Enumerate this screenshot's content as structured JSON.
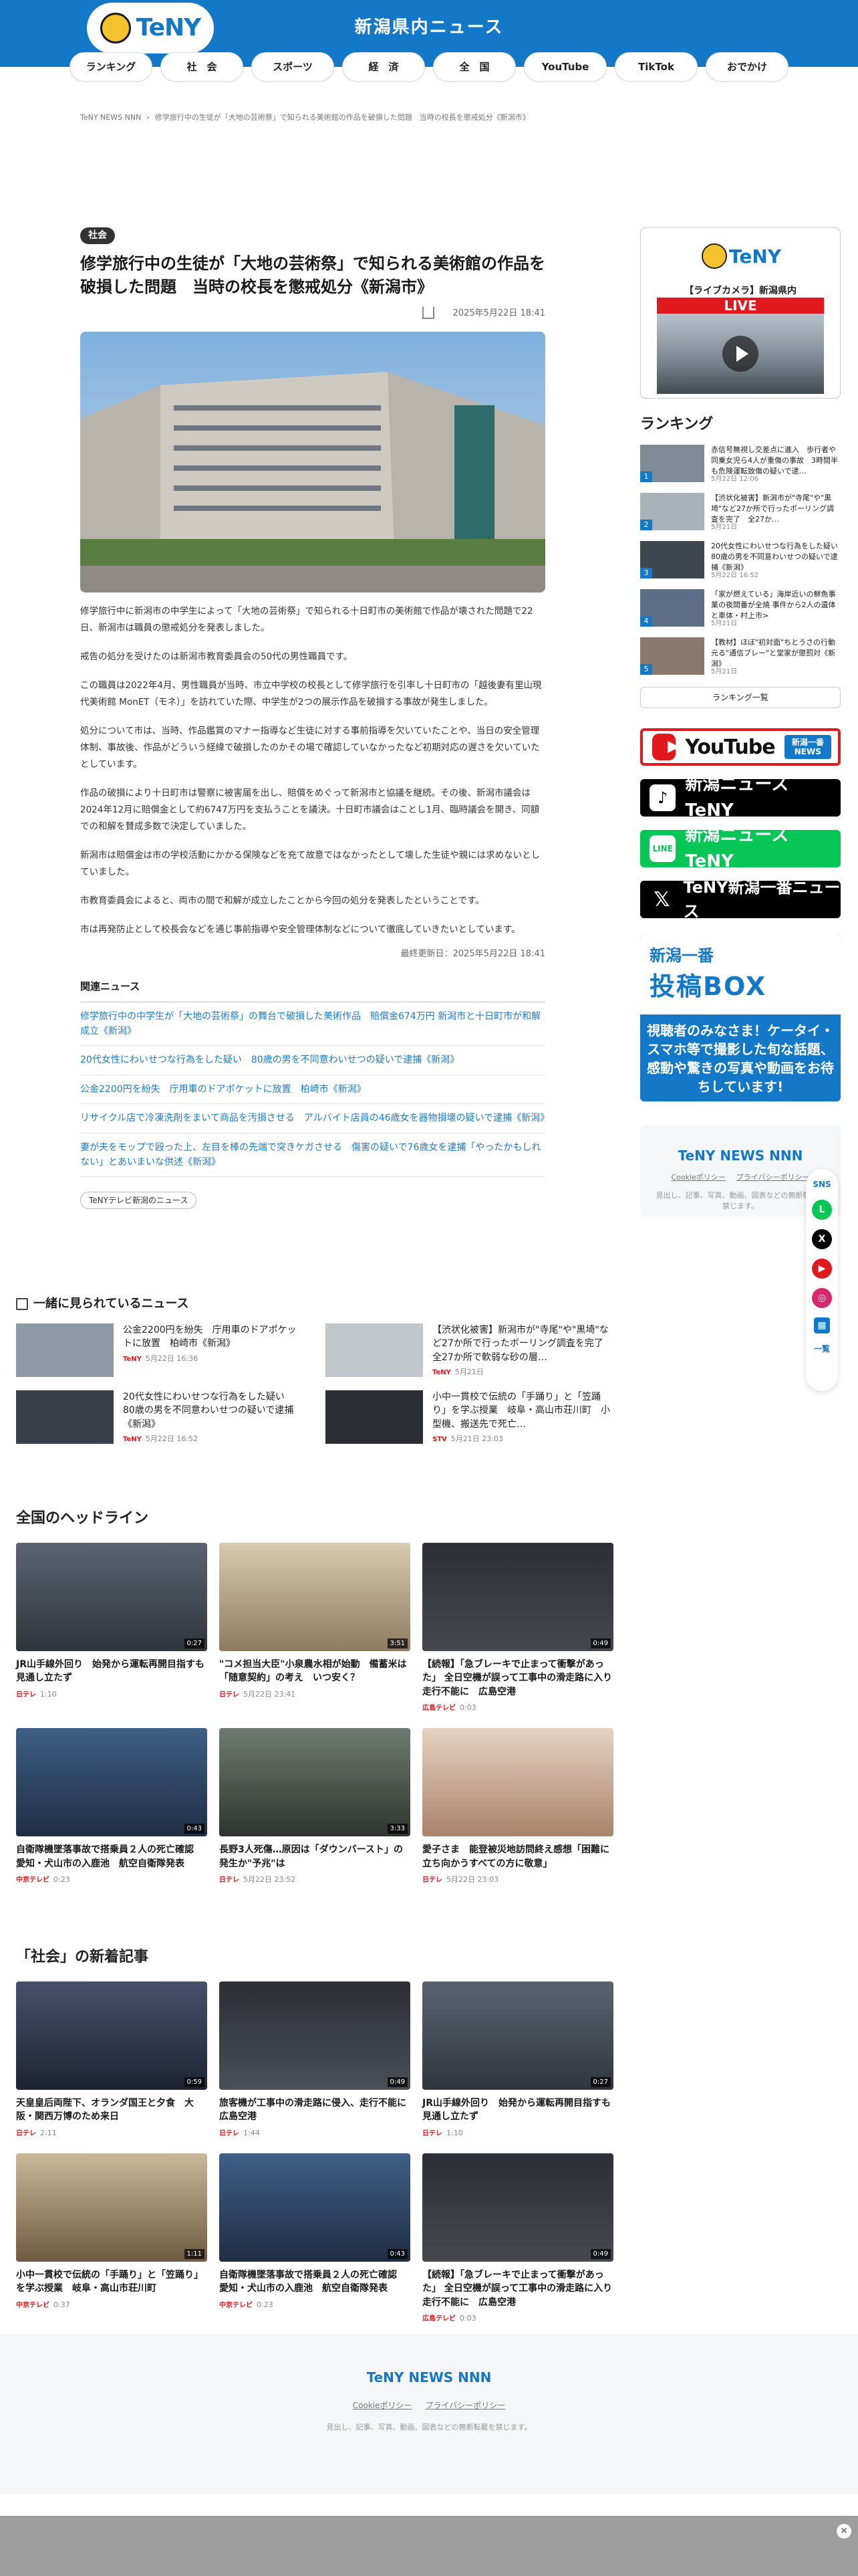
{
  "site": {
    "logo_text": "TeNY",
    "title": "新潟県内ニュース",
    "nav": [
      "ランキング",
      "社　会",
      "スポーツ",
      "経　済",
      "全　国",
      "YouTube",
      "TikTok",
      "おでかけ"
    ]
  },
  "breadcrumb": [
    "TeNY NEWS NNN",
    "修学旅行中の生徒が「大地の芸術祭」で知られる美術館の作品を破損した問題　当時の校長を懲戒処分《新潟市》"
  ],
  "article": {
    "category": "社会",
    "title": "修学旅行中の生徒が「大地の芸術祭」で知られる美術館の作品を破損した問題　当時の校長を懲戒処分《新潟市》",
    "date": "2025年5月22日 18:41",
    "paragraphs": [
      "修学旅行中に新潟市の中学生によって「大地の芸術祭」で知られる十日町市の美術館で作品が壊された問題で22日、新潟市は職員の懲戒処分を発表しました。",
      "戒告の処分を受けたのは新潟市教育委員会の50代の男性職員です。",
      "この職員は2022年4月、男性職員が当時、市立中学校の校長として修学旅行を引率し十日町市の「越後妻有里山現代美術館 MonET（モネ）」を訪れていた際、中学生が2つの展示作品を破損する事故が発生しました。",
      "処分について市は、当時、作品鑑賞のマナー指導など生徒に対する事前指導を欠いていたことや、当日の安全管理体制、事故後、作品がどういう経緯で破損したのかその場で確認していなかったなど初期対応の遅さを欠いていたとしています。",
      "作品の破損により十日町市は警察に被害届を出し、賠償をめぐって新潟市と協議を継続。その後、新潟市議会は2024年12月に賠償金として約6747万円を支払うことを議決。十日町市議会はことし1月、臨時議会を開き、同額での和解を賛成多数で決定していました。",
      "新潟市は賠償金は市の学校活動にかかる保険などを充て故意ではなかったとして壊した生徒や親には求めないとしていました。",
      "市教育委員会によると、両市の間で和解が成立したことから今回の処分を発表したということです。",
      "市は再発防止として校長会などを通じ事前指導や安全管理体制などについて徹底していきたいとしています。"
    ],
    "updated": "最終更新日：2025年5月22日 18:41"
  },
  "related": {
    "title": "関連ニュース",
    "items": [
      "修学旅行中の中学生が「大地の芸術祭」の舞台で破損した美術作品　賠償金674万円 新潟市と十日町市が和解成立《新潟》",
      "20代女性にわいせつな行為をした疑い　80歳の男を不同意わいせつの疑いで逮捕《新潟》",
      "公金2200円を紛失　庁用車のドアポケットに放置　柏崎市《新潟》",
      "リサイクル店で冷凍洗剤をまいて商品を汚損させる　アルバイト店員の46歳女を器物損壊の疑いで逮捕《新潟》",
      "妻が夫をモップで殴った上、左目を棒の先端で突きケガさせる　傷害の疑いで76歳女を逮捕「やったかもしれない」とあいまいな供述《新潟》"
    ],
    "tag": "TeNYテレビ新潟のニュース"
  },
  "sidebar": {
    "live_label": "【ライブカメラ】新潟県内",
    "live_badge": "LIVE",
    "ranking_title": "ランキング",
    "ranking": [
      {
        "n": "1",
        "title": "赤信号無視し交差点に進入　歩行者や同乗女児ら4人が重傷の事故　3時間半も危険運転致傷の疑いで逮…",
        "date": "5月22日 12:06"
      },
      {
        "n": "2",
        "title": "【渋状化被害】新潟市が\"寺尾\"や\"黒埼\"など27か所で行ったボーリング調査を完了　全27か…",
        "date": "5月21日"
      },
      {
        "n": "3",
        "title": "20代女性にわいせつな行為をした疑い　80歳の男を不同意わいせつの疑いで逮捕《新潟》",
        "date": "5月22日 16:52"
      },
      {
        "n": "4",
        "title": "「家が燃えている」海岸近いの鮮魚事業の夜間番が全焼 事件から2人の遺体と車体・村上市>",
        "date": "5月21日"
      },
      {
        "n": "5",
        "title": "【教材】ほぼ\"初対面\"ちとうさの行動　元る\"通信ブレー\"と堂家が懲罰対《新潟》",
        "date": "5月21日"
      }
    ],
    "ranking_more": "ランキング一覧",
    "youtube_word": "YouTube",
    "youtube_tag": "新潟一番 NEWS",
    "tiktok": "新潟ニュース TeNY",
    "line": "新潟ニュース TeNY",
    "x": "TeNY新潟一番ニュース",
    "box_a": "新潟一番",
    "box_b": "投稿BOX",
    "box_text": "視聴者のみなさま！ケータイ・スマホ等で撮影した旬な話題、感動や驚きの写真や動画をお待ちしています!",
    "footer_logo": "TeNY NEWS NNN",
    "footer_links": [
      "Cookieポリシー",
      "プライバシーポリシー"
    ],
    "footer_note": "見出し、記事、写真、動画、図表などの無断転載を禁じます。"
  },
  "float_sns": {
    "label": "SNS",
    "more": "一覧"
  },
  "watching": {
    "title": "一緒に見られているニュース",
    "items": [
      {
        "title": "公金2200円を紛失　庁用車のドアポケットに放置　柏崎市《新潟》",
        "src": "TeNY",
        "date": "5月22日 16:36"
      },
      {
        "title": "【渋状化被害】新潟市が\"寺尾\"や\"黒埼\"など27か所で行ったボーリング調査を完了　全27か所で軟弱な砂の層…",
        "src": "TeNY",
        "date": "5月21日"
      },
      {
        "title": "20代女性にわいせつな行為をした疑い　80歳の男を不同意わいせつの疑いで逮捕《新潟》",
        "src": "TeNY",
        "date": "5月22日 16:52"
      },
      {
        "title": "小中一貫校で伝統の「手踊り」と「笠踊り」を学ぶ授業　岐阜・高山市荘川町　小型機、搬送先で死亡…",
        "src": "STV",
        "date": "5月21日 23:03"
      }
    ]
  },
  "national": {
    "title": "全国のヘッドライン",
    "items": [
      {
        "title": "JR山手線外回り　始発から運転再開目指すも見通し立たず",
        "src": "日テレ",
        "date": "1:10",
        "dur": "0:27"
      },
      {
        "title": "\"コメ担当大臣\"小泉農水相が始動　備蓄米は「随意契約」の考え　いつ安く？",
        "src": "日テレ",
        "date": "5月22日 23:41",
        "dur": "3:51"
      },
      {
        "title": "【続報】「急ブレーキで止まって衝撃があった」 全日空機が誤って工事中の滑走路に入り走行不能に　広島空港",
        "src": "広島テレビ",
        "date": "0:03",
        "dur": "0:49"
      },
      {
        "title": "自衛隊機墜落事故で搭乗員２人の死亡確認　愛知・犬山市の入鹿池　航空自衛隊発表",
        "src": "中京テレビ",
        "date": "0:23",
        "dur": "0:43"
      },
      {
        "title": "長野3人死傷…原因は「ダウンバースト」の発生か\"予兆\"は",
        "src": "日テレ",
        "date": "5月22日 23:52",
        "dur": "3:33"
      },
      {
        "title": "愛子さま　能登被災地訪問終え感想「困難に立ち向かうすべての方に敬意」",
        "src": "日テレ",
        "date": "5月22日 23:03",
        "dur": ""
      }
    ]
  },
  "social": {
    "title": "「社会」の新着記事",
    "items": [
      {
        "title": "天皇皇后両陛下、オランダ国王と夕食　大阪・関西万博のため来日",
        "src": "日テレ",
        "date": "2:11",
        "dur": "0:59"
      },
      {
        "title": "旅客機が工事中の滑走路に侵入、走行不能に　広島空港",
        "src": "日テレ",
        "date": "1:44",
        "dur": "0:49"
      },
      {
        "title": "JR山手線外回り　始発から運転再開目指すも見通し立たず",
        "src": "日テレ",
        "date": "1:10",
        "dur": "0:27"
      },
      {
        "title": "小中一貫校で伝統の「手踊り」と「笠踊り」を学ぶ授業　岐阜・高山市荘川町",
        "src": "中京テレビ",
        "date": "0:37",
        "dur": "1:11"
      },
      {
        "title": "自衛隊機墜落事故で搭乗員２人の死亡確認　愛知・犬山市の入鹿池　航空自衛隊発表",
        "src": "中京テレビ",
        "date": "0:23",
        "dur": "0:43"
      },
      {
        "title": "【続報】「急ブレーキで止まって衝撃があった」 全日空機が誤って工事中の滑走路に入り走行不能に　広島空港",
        "src": "広島テレビ",
        "date": "0:03",
        "dur": "0:49"
      }
    ]
  },
  "footer": {
    "logo": "TeNY NEWS NNN",
    "links": [
      "Cookieポリシー",
      "プライバシーポリシー"
    ],
    "note": "見出し、記事、写真、動画、図表などの無断転載を禁じます。"
  },
  "colors": {
    "brand": "#1478c8",
    "live": "#e0191e",
    "line": "#06c755"
  }
}
